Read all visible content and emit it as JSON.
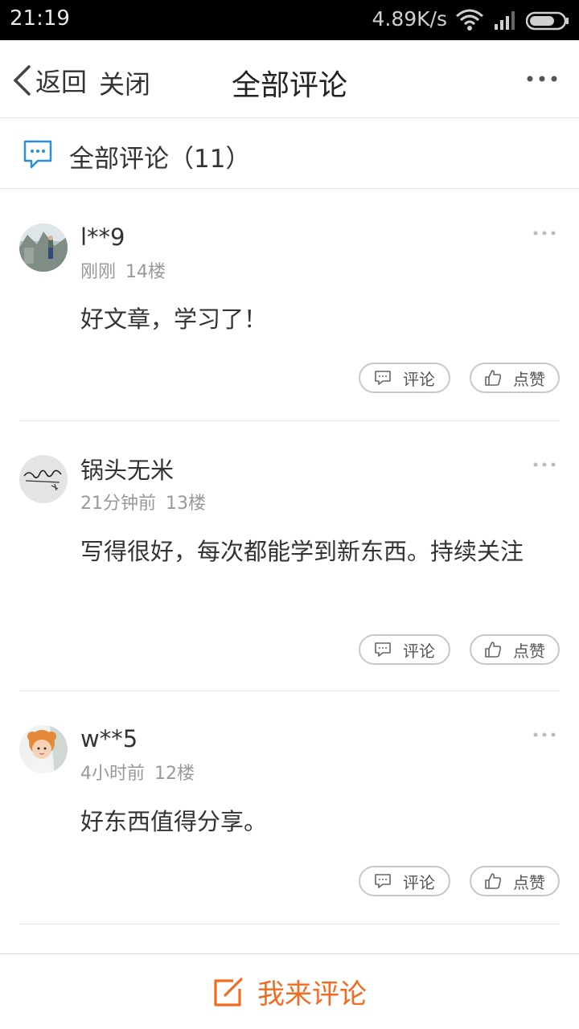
{
  "status_bar": {
    "time": "21:19",
    "speed": "4.89K/s"
  },
  "nav": {
    "back_label": "返回",
    "close_label": "关闭",
    "title": "全部评论"
  },
  "comments_header": {
    "label": "全部评论（11）"
  },
  "comments": [
    {
      "user": "l**9",
      "time": "刚刚",
      "floor": "14楼",
      "text": "好文章，学习了！",
      "reply_label": "评论",
      "like_label": "点赞"
    },
    {
      "user": "锅头无米",
      "time": "21分钟前",
      "floor": "13楼",
      "text": "写得很好，每次都能学到新东西。持续关注",
      "reply_label": "评论",
      "like_label": "点赞"
    },
    {
      "user": "w**5",
      "time": "4小时前",
      "floor": "12楼",
      "text": "好东西值得分享。",
      "reply_label": "评论",
      "like_label": "点赞"
    }
  ],
  "bottom": {
    "label": "我来评论"
  },
  "colors": {
    "accent": "#f26b21",
    "header_icon": "#2b8ed8",
    "divider": "#e3e3e3"
  },
  "icons": [
    "wifi-icon",
    "signal-icon",
    "battery-icon",
    "back-chevron-icon",
    "more-dots-icon",
    "comment-bubble-icon",
    "reply-icon",
    "thumbs-up-icon",
    "edit-icon"
  ]
}
